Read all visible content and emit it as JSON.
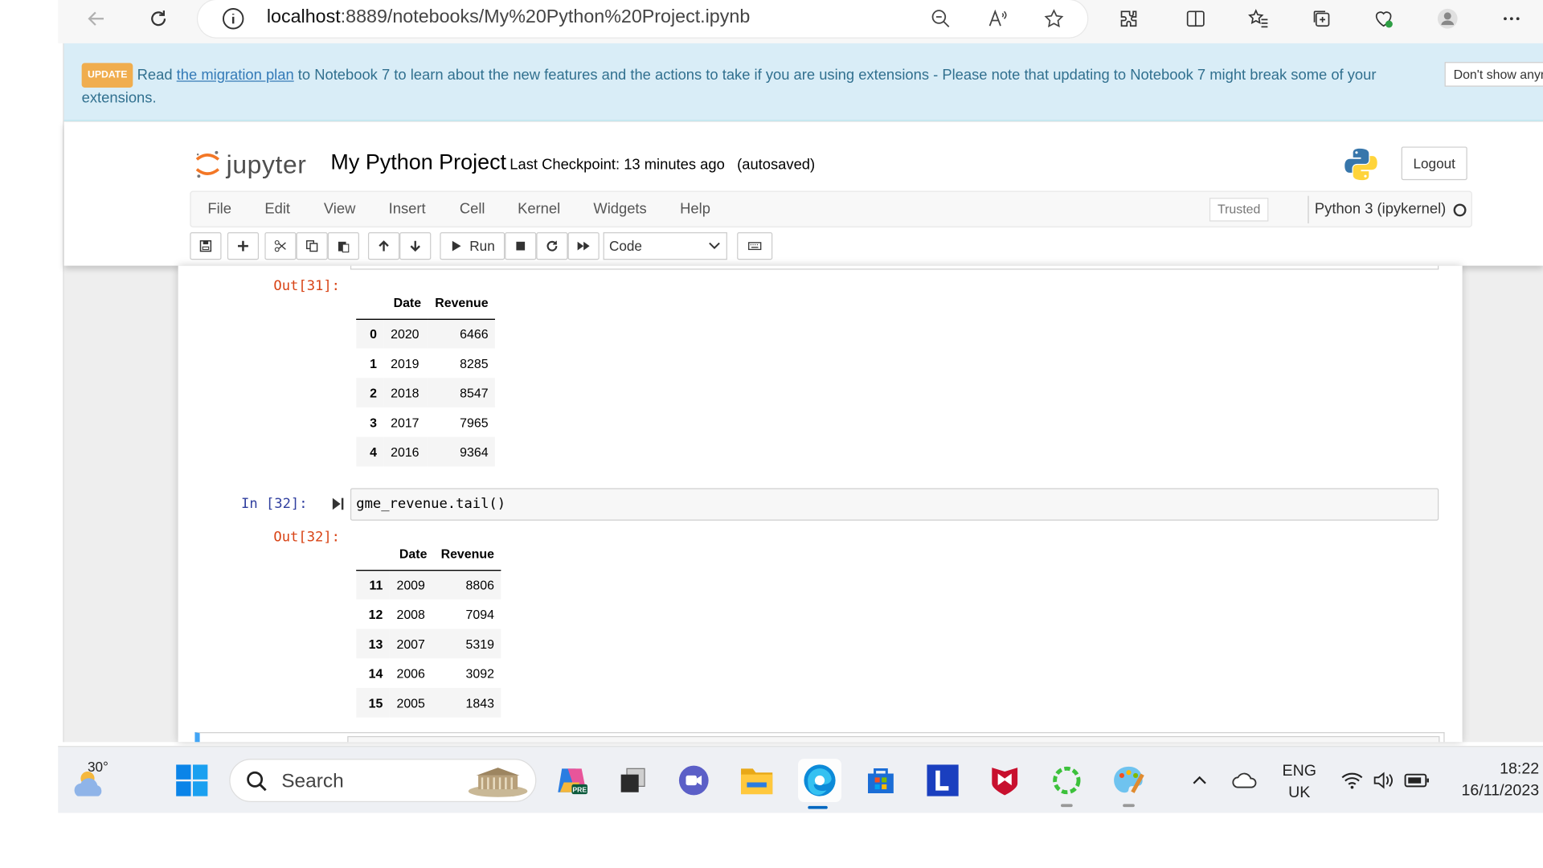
{
  "browser": {
    "url_host": "localhost",
    "url_path": ":8889/notebooks/My%20Python%20Project.ipynb"
  },
  "banner": {
    "badge": "UPDATE",
    "text_before": "Read ",
    "link": "the migration plan",
    "text_after": " to Notebook 7 to learn about the new features and the actions to take if you are using extensions - Please note that updating to Notebook 7 might break some of your extensions.",
    "dismiss": "Don't show anymore"
  },
  "header": {
    "logo_text": "jupyter",
    "title": "My Python Project",
    "checkpoint": "Last Checkpoint: 13 minutes ago",
    "autosave": "(autosaved)",
    "logout": "Logout"
  },
  "menu": {
    "items": [
      "File",
      "Edit",
      "View",
      "Insert",
      "Cell",
      "Kernel",
      "Widgets",
      "Help"
    ],
    "trusted": "Trusted",
    "kernel": "Python 3 (ipykernel)"
  },
  "toolbar": {
    "run": "Run",
    "cell_type": "Code"
  },
  "cells": {
    "out31_prompt": "Out[31]:",
    "in32_prompt": "In [32]:",
    "in32_code": "gme_revenue.tail()",
    "out32_prompt": "Out[32]:",
    "table_headers": [
      "Date",
      "Revenue"
    ],
    "head_rows": [
      {
        "idx": "0",
        "date": "2020",
        "revenue": "6466"
      },
      {
        "idx": "1",
        "date": "2019",
        "revenue": "8285"
      },
      {
        "idx": "2",
        "date": "2018",
        "revenue": "8547"
      },
      {
        "idx": "3",
        "date": "2017",
        "revenue": "7965"
      },
      {
        "idx": "4",
        "date": "2016",
        "revenue": "9364"
      }
    ],
    "tail_rows": [
      {
        "idx": "11",
        "date": "2009",
        "revenue": "8806"
      },
      {
        "idx": "12",
        "date": "2008",
        "revenue": "7094"
      },
      {
        "idx": "13",
        "date": "2007",
        "revenue": "5319"
      },
      {
        "idx": "14",
        "date": "2006",
        "revenue": "3092"
      },
      {
        "idx": "15",
        "date": "2005",
        "revenue": "1843"
      }
    ]
  },
  "taskbar": {
    "temperature": "30°",
    "search": "Search",
    "lang_top": "ENG",
    "lang_bottom": "UK",
    "time": "18:22",
    "date": "16/11/2023"
  }
}
